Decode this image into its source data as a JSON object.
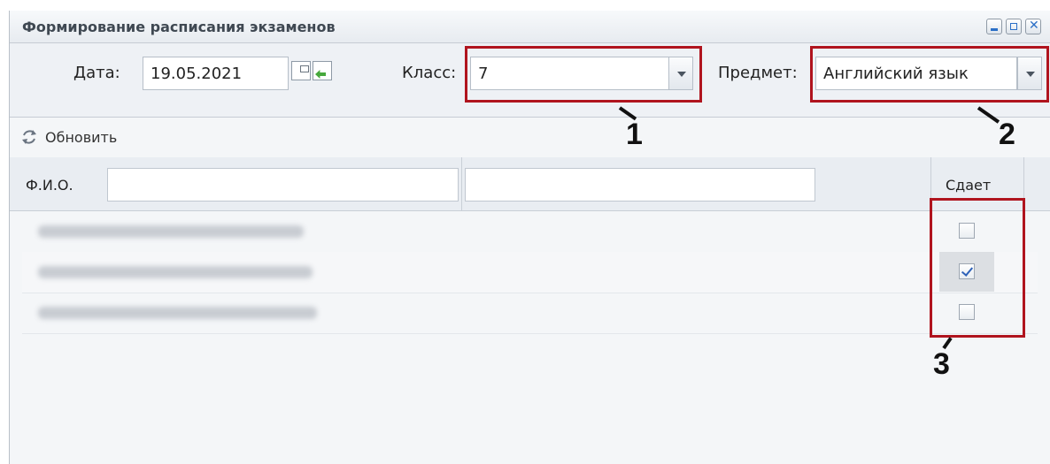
{
  "window": {
    "title": "Формирование расписания экзаменов"
  },
  "form": {
    "date_label": "Дата:",
    "date_value": "19.05.2021",
    "class_label": "Класс:",
    "class_value": "7",
    "subject_label": "Предмет:",
    "subject_value": "Английский язык"
  },
  "toolbar": {
    "refresh_label": "Обновить"
  },
  "grid": {
    "col_fio": "Ф.И.О.",
    "col_sdaet": "Сдает",
    "rows": [
      {
        "checked": false
      },
      {
        "checked": true
      },
      {
        "checked": false
      }
    ]
  },
  "callouts": {
    "c1": "1",
    "c2": "2",
    "c3": "3"
  },
  "colors": {
    "annotation_red": "#b0141e",
    "checkbox_blue": "#2e62b8"
  }
}
